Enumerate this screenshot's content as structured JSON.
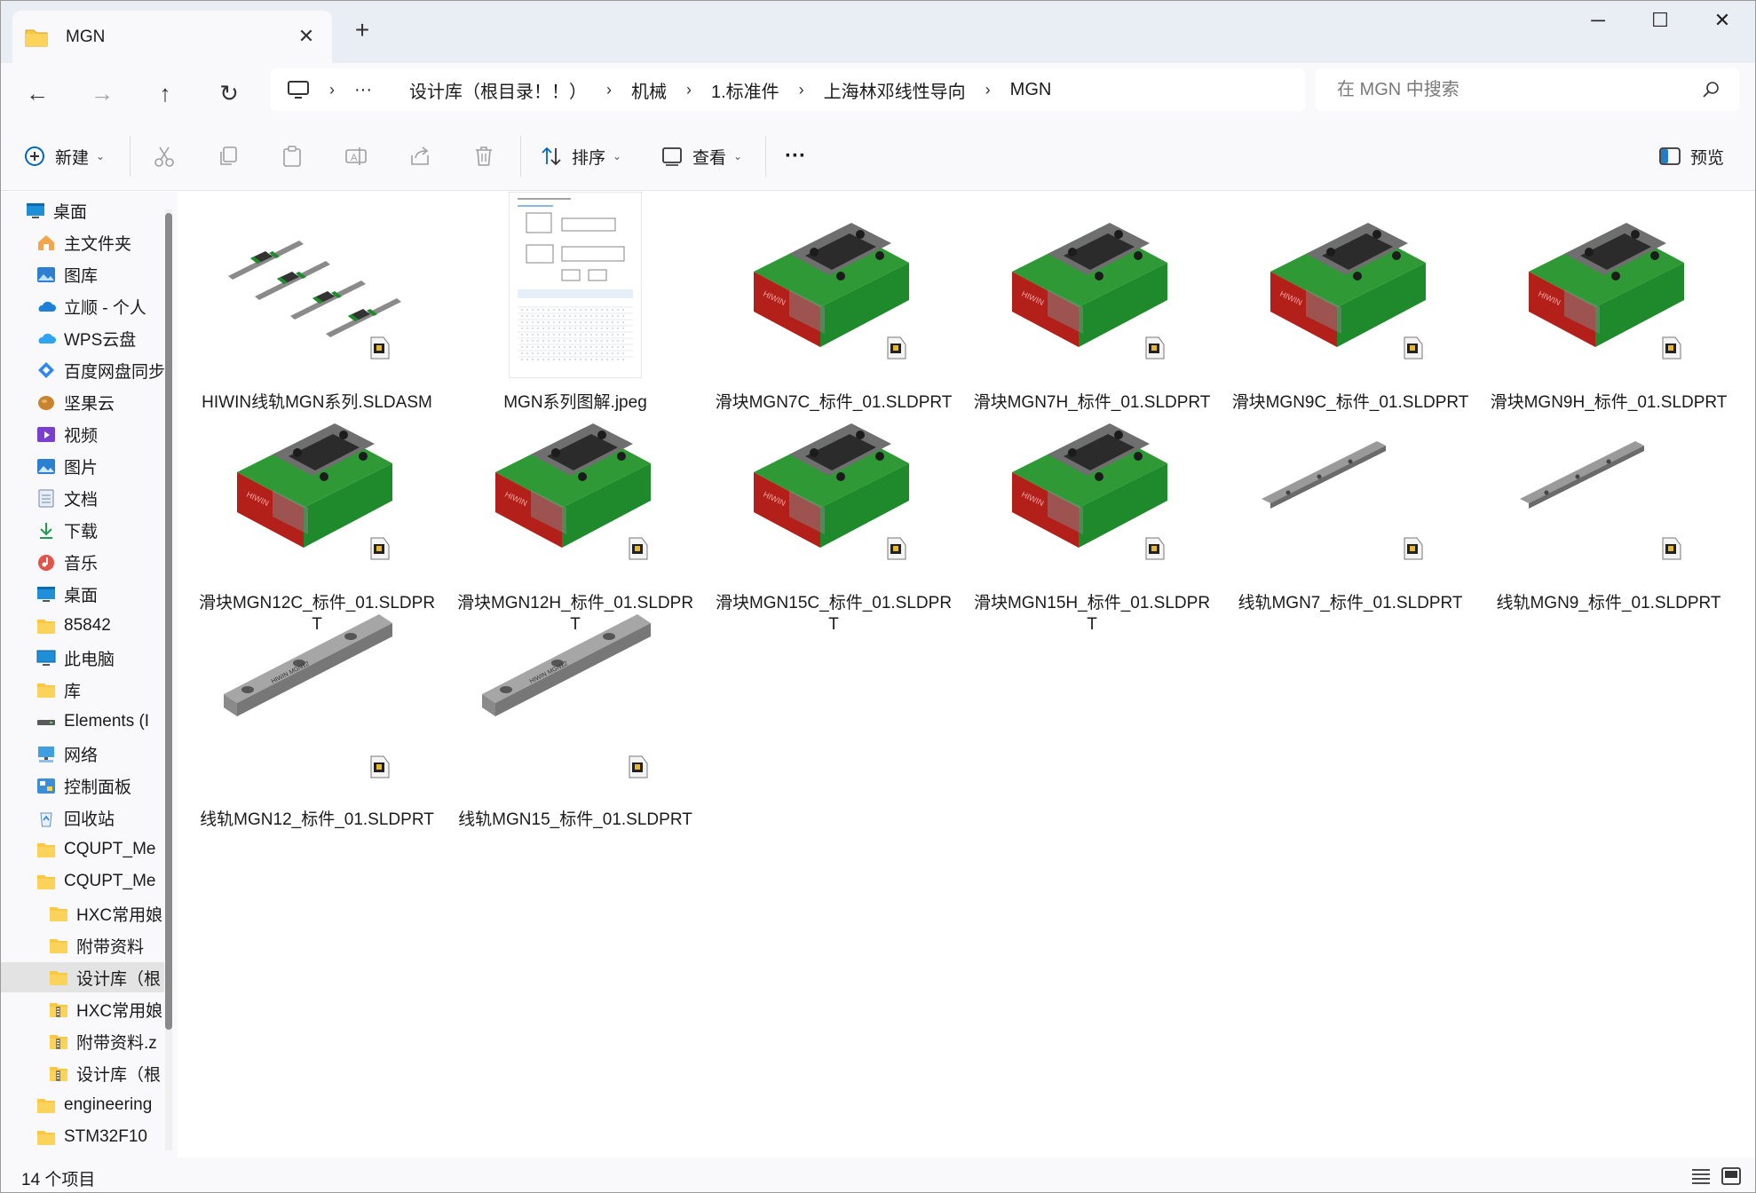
{
  "window": {
    "tab_title": "MGN",
    "new_tab_glyph": "+",
    "minimize_glyph": "─",
    "maximize_glyph": "☐",
    "close_glyph": "✕"
  },
  "nav": {
    "back_glyph": "←",
    "forward_glyph": "→",
    "up_glyph": "↑",
    "refresh_glyph": "↻"
  },
  "breadcrumb": {
    "overflow": "···",
    "items": [
      "设计库（根目录！！）",
      "机械",
      "1.标准件",
      "上海林邓线性导向",
      "MGN"
    ]
  },
  "search": {
    "placeholder": "在 MGN 中搜索"
  },
  "toolbar": {
    "new_label": "新建",
    "sort_label": "排序",
    "view_label": "查看",
    "more_label": "···",
    "preview_label": "预览"
  },
  "sidebar": {
    "items": [
      {
        "label": "桌面",
        "icon": "desktop-icon"
      },
      {
        "label": "主文件夹",
        "icon": "home-icon"
      },
      {
        "label": "图库",
        "icon": "gallery-icon"
      },
      {
        "label": "立顺 - 个人",
        "icon": "onedrive-icon"
      },
      {
        "label": "WPS云盘",
        "icon": "wps-cloud-icon"
      },
      {
        "label": "百度网盘同步",
        "icon": "baidu-netdisk-icon"
      },
      {
        "label": "坚果云",
        "icon": "nutstore-icon"
      },
      {
        "label": "视频",
        "icon": "videos-icon"
      },
      {
        "label": "图片",
        "icon": "pictures-icon"
      },
      {
        "label": "文档",
        "icon": "documents-icon"
      },
      {
        "label": "下载",
        "icon": "downloads-icon"
      },
      {
        "label": "音乐",
        "icon": "music-icon"
      },
      {
        "label": "桌面",
        "icon": "desktop-icon"
      },
      {
        "label": "85842",
        "icon": "folder-icon"
      },
      {
        "label": "此电脑",
        "icon": "this-pc-icon"
      },
      {
        "label": "库",
        "icon": "folder-icon"
      },
      {
        "label": "Elements (I",
        "icon": "drive-icon"
      },
      {
        "label": "网络",
        "icon": "network-icon"
      },
      {
        "label": "控制面板",
        "icon": "control-panel-icon"
      },
      {
        "label": "回收站",
        "icon": "recycle-bin-icon"
      },
      {
        "label": "CQUPT_Me",
        "icon": "folder-icon"
      },
      {
        "label": "CQUPT_Me",
        "icon": "folder-icon"
      },
      {
        "label": "HXC常用娘",
        "icon": "folder-icon"
      },
      {
        "label": "附带资料",
        "icon": "folder-icon"
      },
      {
        "label": "设计库（根",
        "icon": "folder-icon"
      },
      {
        "label": "HXC常用娘",
        "icon": "zip-folder-icon"
      },
      {
        "label": "附带资料.z",
        "icon": "zip-folder-icon"
      },
      {
        "label": "设计库（根",
        "icon": "zip-folder-icon"
      },
      {
        "label": "engineering",
        "icon": "folder-icon"
      },
      {
        "label": "STM32F10",
        "icon": "folder-icon"
      }
    ]
  },
  "files": [
    {
      "name": "HIWIN线轨MGN系列.SLDASM",
      "kind": "assembly"
    },
    {
      "name": "MGN系列图解.jpeg",
      "kind": "image"
    },
    {
      "name": "滑块MGN7C_标件_01.SLDPRT",
      "kind": "block"
    },
    {
      "name": "滑块MGN7H_标件_01.SLDPRT",
      "kind": "block"
    },
    {
      "name": "滑块MGN9C_标件_01.SLDPRT",
      "kind": "block"
    },
    {
      "name": "滑块MGN9H_标件_01.SLDPRT",
      "kind": "block"
    },
    {
      "name": "滑块MGN12C_标件_01.SLDPRT",
      "kind": "block"
    },
    {
      "name": "滑块MGN12H_标件_01.SLDPRT",
      "kind": "block"
    },
    {
      "name": "滑块MGN15C_标件_01.SLDPRT",
      "kind": "block"
    },
    {
      "name": "滑块MGN15H_标件_01.SLDPRT",
      "kind": "block"
    },
    {
      "name": "线轨MGN7_标件_01.SLDPRT",
      "kind": "rail-thin"
    },
    {
      "name": "线轨MGN9_标件_01.SLDPRT",
      "kind": "rail-thin"
    },
    {
      "name": "线轨MGN12_标件_01.SLDPRT",
      "kind": "rail-wide"
    },
    {
      "name": "线轨MGN15_标件_01.SLDPRT",
      "kind": "rail-wide"
    }
  ],
  "status": {
    "item_count": "14 个项目"
  },
  "colors": {
    "accent": "#0067c0",
    "folder": "#f8c843",
    "block_green": "#1f8a2b",
    "block_red": "#b3201a",
    "block_gray": "#6b6b6b"
  }
}
